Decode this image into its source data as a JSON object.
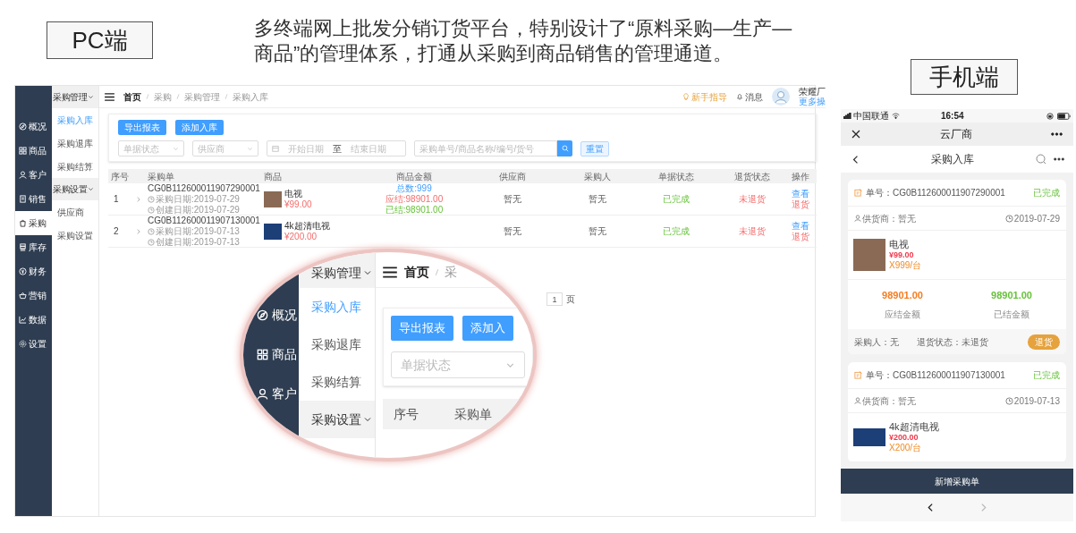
{
  "labels": {
    "pc": "PC端",
    "mobile": "手机端"
  },
  "headline": "多终端网上批发分销订货平台，特别设计了“原料采购—生产—商品”的管理体系，打通从采购到商品销售的管理通道。",
  "pc": {
    "sidebar": [
      {
        "label": "概况",
        "selected": false
      },
      {
        "label": "商品",
        "selected": false
      },
      {
        "label": "客户",
        "selected": false
      },
      {
        "label": "销售",
        "selected": false
      },
      {
        "label": "采购",
        "selected": true
      },
      {
        "label": "库存",
        "selected": false
      },
      {
        "label": "财务",
        "selected": false
      },
      {
        "label": "营销",
        "selected": false
      },
      {
        "label": "数据",
        "selected": false
      },
      {
        "label": "设置",
        "selected": false
      }
    ],
    "submenu": [
      {
        "kind": "group",
        "label": "采购管理",
        "expanded": true
      },
      {
        "kind": "item",
        "label": "采购入库",
        "selected": true
      },
      {
        "kind": "item",
        "label": "采购退库",
        "selected": false
      },
      {
        "kind": "item",
        "label": "采购结算",
        "selected": false
      },
      {
        "kind": "group",
        "label": "采购设置",
        "expanded": true
      },
      {
        "kind": "item",
        "label": "供应商",
        "selected": false
      },
      {
        "kind": "item",
        "label": "采购设置",
        "selected": false
      }
    ],
    "breadcrumb": [
      "首页",
      "采购",
      "采购管理",
      "采购入库"
    ],
    "guide": "新手指导",
    "messages": "消息",
    "user_name": "荣耀厂",
    "user_link": "更多操",
    "buttons": [
      "导出报表",
      "添加入库"
    ],
    "filters": {
      "status_placeholder": "单据状态",
      "supplier_placeholder": "供应商",
      "start_placeholder": "开始日期",
      "range_separator": "至",
      "end_placeholder": "结束日期",
      "search_placeholder": "采购单号/商品名称/编号/货号",
      "reset": "重置"
    },
    "table": {
      "columns": [
        "序号",
        "采购单",
        "商品",
        "商品金额",
        "供应商",
        "采购人",
        "单据状态",
        "退货状态",
        "操作"
      ],
      "rows": [
        {
          "index": "1",
          "order_no": "CG0B112600011907290001",
          "purchase_date": "采购日期:2019-07-29",
          "created_date": "创建日期:2019-07-29",
          "product": "电视",
          "price": "¥99.00",
          "amounts": {
            "total": "总数:999",
            "payable": "应结:98901.00",
            "paid": "已结:98901.00"
          },
          "supplier": "暂无",
          "buyer": "暂无",
          "order_status": "已完成",
          "return_status": "未退货",
          "actions": [
            {
              "kind": "view",
              "label": "查看"
            },
            {
              "kind": "return",
              "label": "退货"
            }
          ]
        },
        {
          "index": "2",
          "order_no": "CG0B112600011907130001",
          "purchase_date": "采购日期:2019-07-13",
          "created_date": "创建日期:2019-07-13",
          "product": "4k超清电视",
          "price": "¥200.00",
          "supplier": "暂无",
          "buyer": "暂无",
          "order_status": "已完成",
          "return_status": "未退货",
          "actions": [
            {
              "kind": "view",
              "label": "查看"
            },
            {
              "kind": "return",
              "label": "退货"
            }
          ]
        }
      ]
    },
    "pagination": {
      "page": "1",
      "unit": "页"
    }
  },
  "magnifier": {
    "sidebar": [
      {
        "label": "概况"
      },
      {
        "label": "商品"
      },
      {
        "label": "客户"
      }
    ],
    "submenu": [
      {
        "kind": "group",
        "label": "采购管理",
        "expanded": true
      },
      {
        "kind": "item",
        "label": "采购入库",
        "selected": true
      },
      {
        "kind": "item",
        "label": "采购退库",
        "selected": false
      },
      {
        "kind": "item",
        "label": "采购结算",
        "selected": false
      },
      {
        "kind": "group",
        "label": "采购设置",
        "expanded": true
      }
    ],
    "breadcrumb": [
      "首页",
      "采"
    ],
    "buttons": [
      "导出报表",
      "添加入"
    ],
    "status_placeholder": "单据状态",
    "columns": [
      "序号",
      "采购单"
    ]
  },
  "mobile": {
    "status_bar": {
      "carrier": "中国联通",
      "time": "16:54"
    },
    "title": "云厂商",
    "page_title": "采购入库",
    "orders": [
      {
        "order_label": "单号：",
        "order_no": "CG0B112600011907290001",
        "status": "已完成",
        "supplier": "供货商：暂无",
        "date": "2019-07-29",
        "product": {
          "name": "电视",
          "price": "¥99.00",
          "qty": "X999/台"
        },
        "payable": "98901.00",
        "payable_label": "应结金额",
        "paid": "98901.00",
        "paid_label": "已结金额",
        "buyer": "采购人：无",
        "return_status": "退货状态：未退货",
        "return_button": "退货"
      },
      {
        "order_label": "单号：",
        "order_no": "CG0B112600011907130001",
        "status": "已完成",
        "supplier": "供货商：暂无",
        "date": "2019-07-13",
        "product": {
          "name": "4k超清电视",
          "price": "¥200.00",
          "qty": "X200/台"
        }
      }
    ],
    "add_button": "新增采购单",
    "nav": {
      "back_disabled": false,
      "forward_disabled": true
    }
  }
}
